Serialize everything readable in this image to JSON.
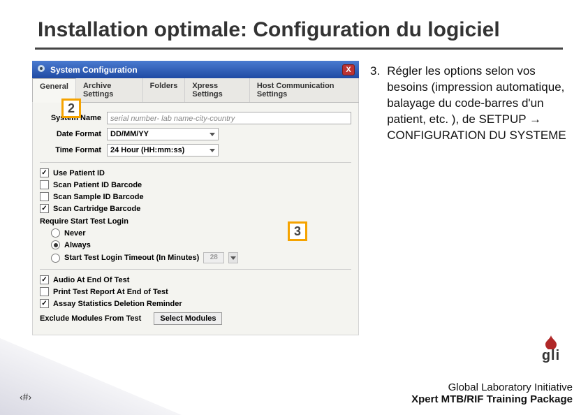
{
  "title": "Installation optimale: Configuration du logiciel",
  "bullet": {
    "num": "3.",
    "text": "Régler les options selon vos besoins (impression automatique, balayage du code-barres d'un patient, etc. ), de SETPUP → CONFIGURATION DU SYSTEME"
  },
  "dialog": {
    "title": "System Configuration",
    "close": "X",
    "tabs": [
      "General",
      "Archive Settings",
      "Folders",
      "Xpress Settings",
      "Host Communication Settings"
    ],
    "form": {
      "sysname_label": "System Name",
      "sysname_value": "serial number- lab name-city-country",
      "dateformat_label": "Date Format",
      "dateformat_value": "DD/MM/YY",
      "timeformat_label": "Time Format",
      "timeformat_value": "24 Hour (HH:mm:ss)"
    },
    "checks": {
      "use_patient_id": {
        "label": "Use Patient ID",
        "checked": true
      },
      "scan_patient_barcode": {
        "label": "Scan Patient ID Barcode",
        "checked": false
      },
      "scan_sample_barcode": {
        "label": "Scan Sample ID Barcode",
        "checked": false
      },
      "scan_cartridge_barcode": {
        "label": "Scan Cartridge Barcode",
        "checked": true
      }
    },
    "require_login_label": "Require Start Test Login",
    "radios": {
      "never": {
        "label": "Never",
        "checked": false
      },
      "always": {
        "label": "Always",
        "checked": true
      },
      "timeout": {
        "label": "Start Test Login Timeout (In Minutes)",
        "checked": false,
        "value": "28"
      }
    },
    "checks2": {
      "audio_end": {
        "label": "Audio At End Of Test",
        "checked": true
      },
      "print_end": {
        "label": "Print Test Report At End of Test",
        "checked": false
      },
      "assay_stats": {
        "label": "Assay Statistics Deletion Reminder",
        "checked": true
      }
    },
    "exclude_label": "Exclude Modules From Test",
    "select_modules_btn": "Select Modules"
  },
  "markers": {
    "m2": "2",
    "m3": "3"
  },
  "footer": {
    "line1": "Global Laboratory Initiative",
    "line2": "Xpert MTB/RIF Training Package"
  },
  "pagenum": "‹#›",
  "logo_text": "gli"
}
